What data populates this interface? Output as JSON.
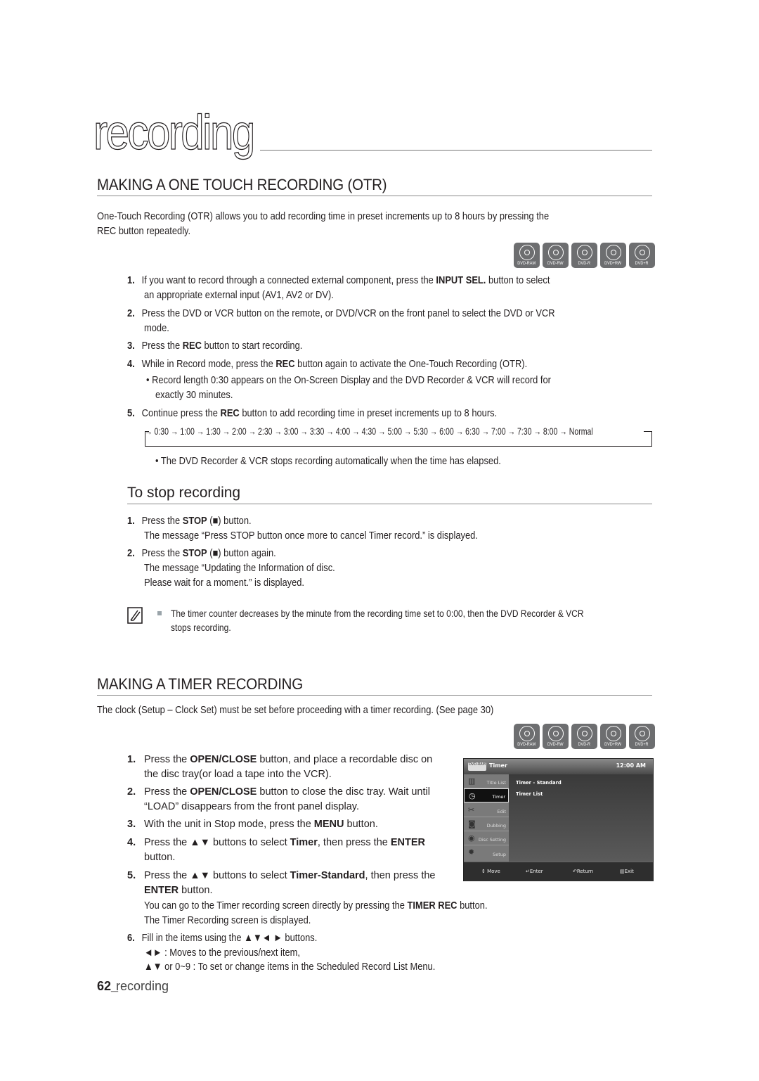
{
  "chapter_title": "recording",
  "otr": {
    "heading": "MAKING A ONE TOUCH RECORDING (OTR)",
    "intro_line1": "One-Touch Recording (OTR) allows you to add recording time in preset increments up to 8 hours by pressing the",
    "intro_line2": "REC button repeatedly.",
    "disc_badges": [
      "DVD-RAM",
      "DVD-RW",
      "DVD-R",
      "DVD+RW",
      "DVD+R"
    ],
    "steps": [
      {
        "num": "1.",
        "pre": "If you want to record through a connected external component, press the ",
        "bold": "INPUT SEL.",
        "post": " button to select",
        "line2": "an appropriate external input (AV1, AV2 or DV)."
      },
      {
        "num": "2.",
        "line1": "Press the DVD or VCR button on the remote, or DVD/VCR on the front panel to select the DVD or VCR",
        "line2": "mode."
      },
      {
        "num": "3.",
        "pre": "Press the ",
        "bold": "REC",
        "post": " button to start recording."
      },
      {
        "num": "4.",
        "pre": "While in Record mode, press the ",
        "bold": "REC",
        "post": " button again to activate the One-Touch Recording (OTR).",
        "bullet_line1": "Record length 0:30 appears on the On-Screen Display and the DVD Recorder & VCR will record for",
        "bullet_line2": "exactly 30 minutes."
      },
      {
        "num": "5.",
        "pre": "Continue press the ",
        "bold": "REC",
        "post": " button to add recording time in preset increments up to 8 hours."
      }
    ],
    "sequence": [
      "0:30",
      "1:00",
      "1:30",
      "2:00",
      "2:30",
      "3:00",
      "3:30",
      "4:00",
      "4:30",
      "5:00",
      "5:30",
      "6:00",
      "6:30",
      "7:00",
      "7:30",
      "8:00",
      "Normal"
    ],
    "after_bullet": "The DVD Recorder & VCR stops recording automatically when the time has elapsed."
  },
  "stop": {
    "heading": "To stop recording",
    "steps": [
      {
        "num": "1.",
        "pre": "Press the ",
        "bold": "STOP",
        "post": " (■) button.",
        "line2": "The message “Press STOP button once more to cancel Timer record.” is displayed."
      },
      {
        "num": "2.",
        "pre": "Press the ",
        "bold": "STOP",
        "post": " (■) button again.",
        "line2": "The message “Updating the Information of disc.",
        "line3": "Please wait for a moment.” is displayed."
      }
    ],
    "note_line1": "The timer counter decreases by the minute from the recording time set to 0:00, then the DVD Recorder & VCR",
    "note_line2": "stops recording."
  },
  "timer": {
    "heading": "MAKING A TIMER RECORDING",
    "intro": "The clock (Setup – Clock Set) must be set before proceeding with a timer recording. (See page 30)",
    "disc_badges": [
      "DVD-RAM",
      "DVD-RW",
      "DVD-R",
      "DVD+RW",
      "DVD+R"
    ],
    "steps": [
      {
        "num": "1.",
        "pre": "Press the ",
        "bold": "OPEN/CLOSE",
        "post": " button, and place a recordable disc on",
        "line2": "the disc tray(or load a tape into the VCR)."
      },
      {
        "num": "2.",
        "pre": "Press the ",
        "bold": "OPEN/CLOSE",
        "post": " button to close the disc tray. Wait until",
        "line2": "“LOAD” disappears from the front panel display."
      },
      {
        "num": "3.",
        "pre": "With the unit in Stop mode, press the ",
        "bold": "MENU",
        "post": " button."
      },
      {
        "num": "4.",
        "pre": "Press the ▲▼ buttons to select ",
        "bold": "Timer",
        "mid": ", then press the ",
        "bold2": "ENTER",
        "line2": "button."
      },
      {
        "num": "5.",
        "pre": "Press the ▲▼ buttons to select ",
        "bold": "Timer-Standard",
        "post": ", then press the",
        "line2_bold": "ENTER",
        "line2_post": " button.",
        "line3_pre": "You can go to the Timer recording screen directly by pressing the ",
        "line3_bold": "TIMER REC",
        "line3_post": " button.",
        "line4": "The Timer Recording screen is displayed."
      },
      {
        "num": "6.",
        "line1": "Fill in the items using the ▲▼◄ ► buttons.",
        "line2": "◄► : Moves to the previous/next item,",
        "line3": "▲▼ or 0~9 : To set or change items in the Scheduled Record List Menu."
      }
    ],
    "osd": {
      "disc_logo": "DVD-RAM",
      "title": "Timer",
      "clock": "12:00 AM",
      "menu": [
        {
          "label": "Title List",
          "icon": "film-icon"
        },
        {
          "label": "Timer",
          "icon": "clock-icon",
          "selected": true
        },
        {
          "label": "Edit",
          "icon": "scissors-icon"
        },
        {
          "label": "Dubbing",
          "icon": "dubbing-icon"
        },
        {
          "label": "Disc Setting",
          "icon": "disc-icon"
        },
        {
          "label": "Setup",
          "icon": "gear-icon"
        }
      ],
      "options": [
        "Timer - Standard",
        "Timer List"
      ],
      "footer": {
        "move": "↕ Move",
        "enter": "↵Enter",
        "return": "↶Return",
        "exit": "▥Exit"
      }
    }
  },
  "footer": {
    "page_number": "62_",
    "section": "recording"
  }
}
